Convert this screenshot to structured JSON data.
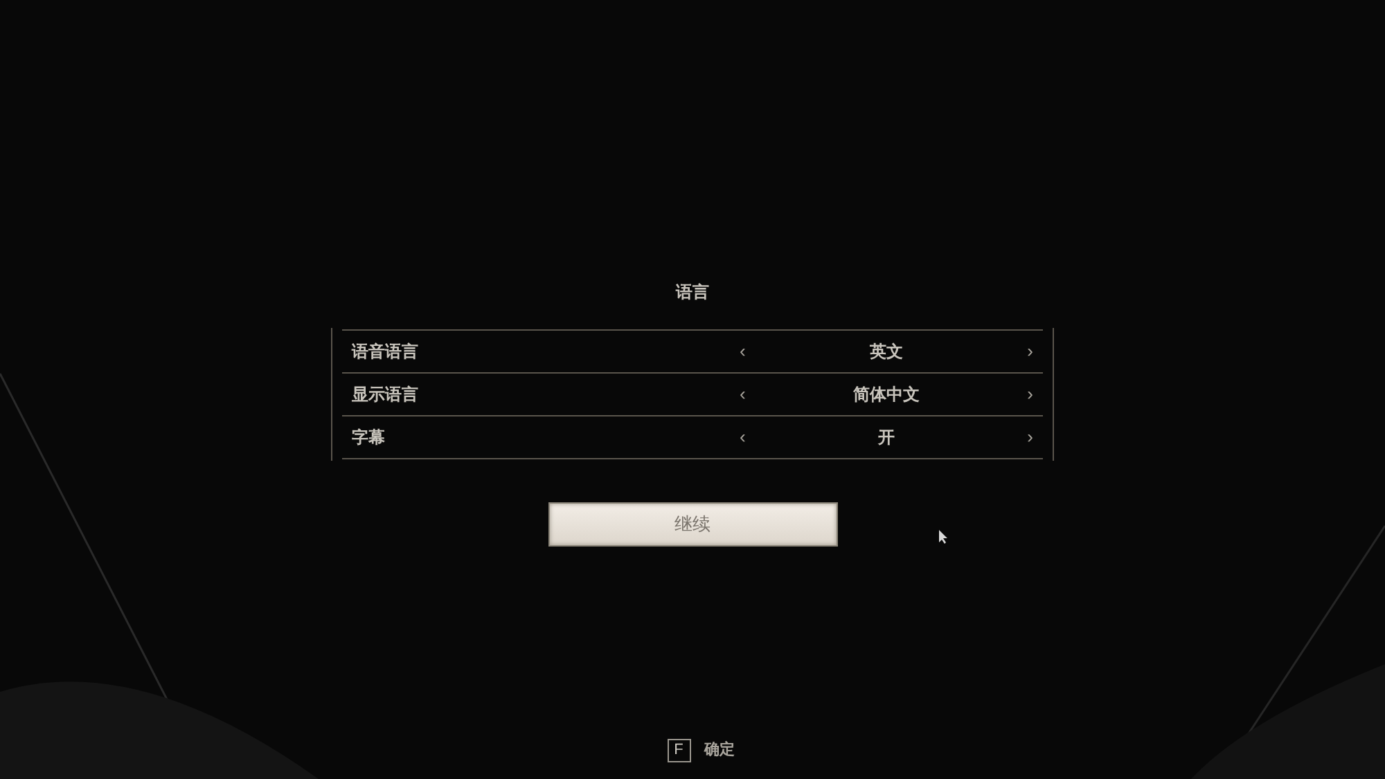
{
  "title": "语言",
  "settings": [
    {
      "label": "语音语言",
      "prev": "‹",
      "value": "英文",
      "next": "›"
    },
    {
      "label": "显示语言",
      "prev": "‹",
      "value": "简体中文",
      "next": "›"
    },
    {
      "label": "字幕",
      "prev": "‹",
      "value": "开",
      "next": "›"
    }
  ],
  "continue_button": "继续",
  "footer": {
    "key": "F",
    "action": "确定"
  }
}
